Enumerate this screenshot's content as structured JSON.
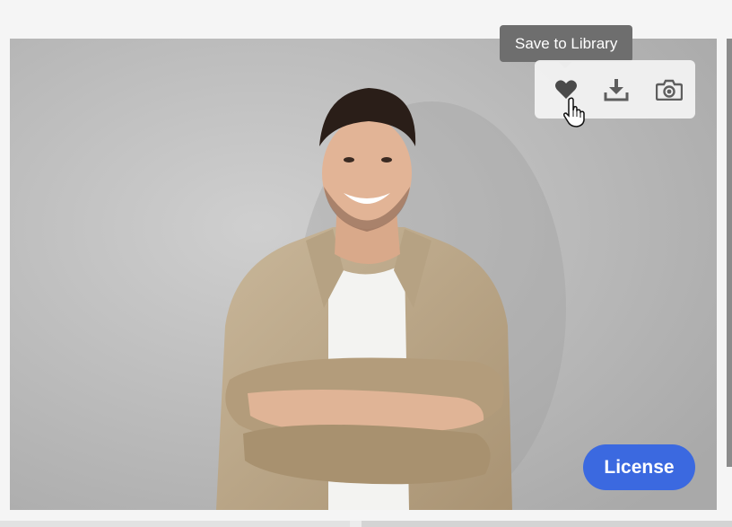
{
  "image_card": {
    "tooltip_text": "Save to Library",
    "license_label": "License",
    "photo_description_icon": "stock-photo-smiling-man",
    "toolbar": [
      {
        "icon": "heart-icon",
        "name": "save-to-library-button"
      },
      {
        "icon": "download-icon",
        "name": "download-button"
      },
      {
        "icon": "camera-icon",
        "name": "find-similar-button"
      }
    ]
  },
  "colors": {
    "license_button": "#3b69e0",
    "tooltip_bg": "#6e6e6e",
    "icon": "#555555"
  }
}
